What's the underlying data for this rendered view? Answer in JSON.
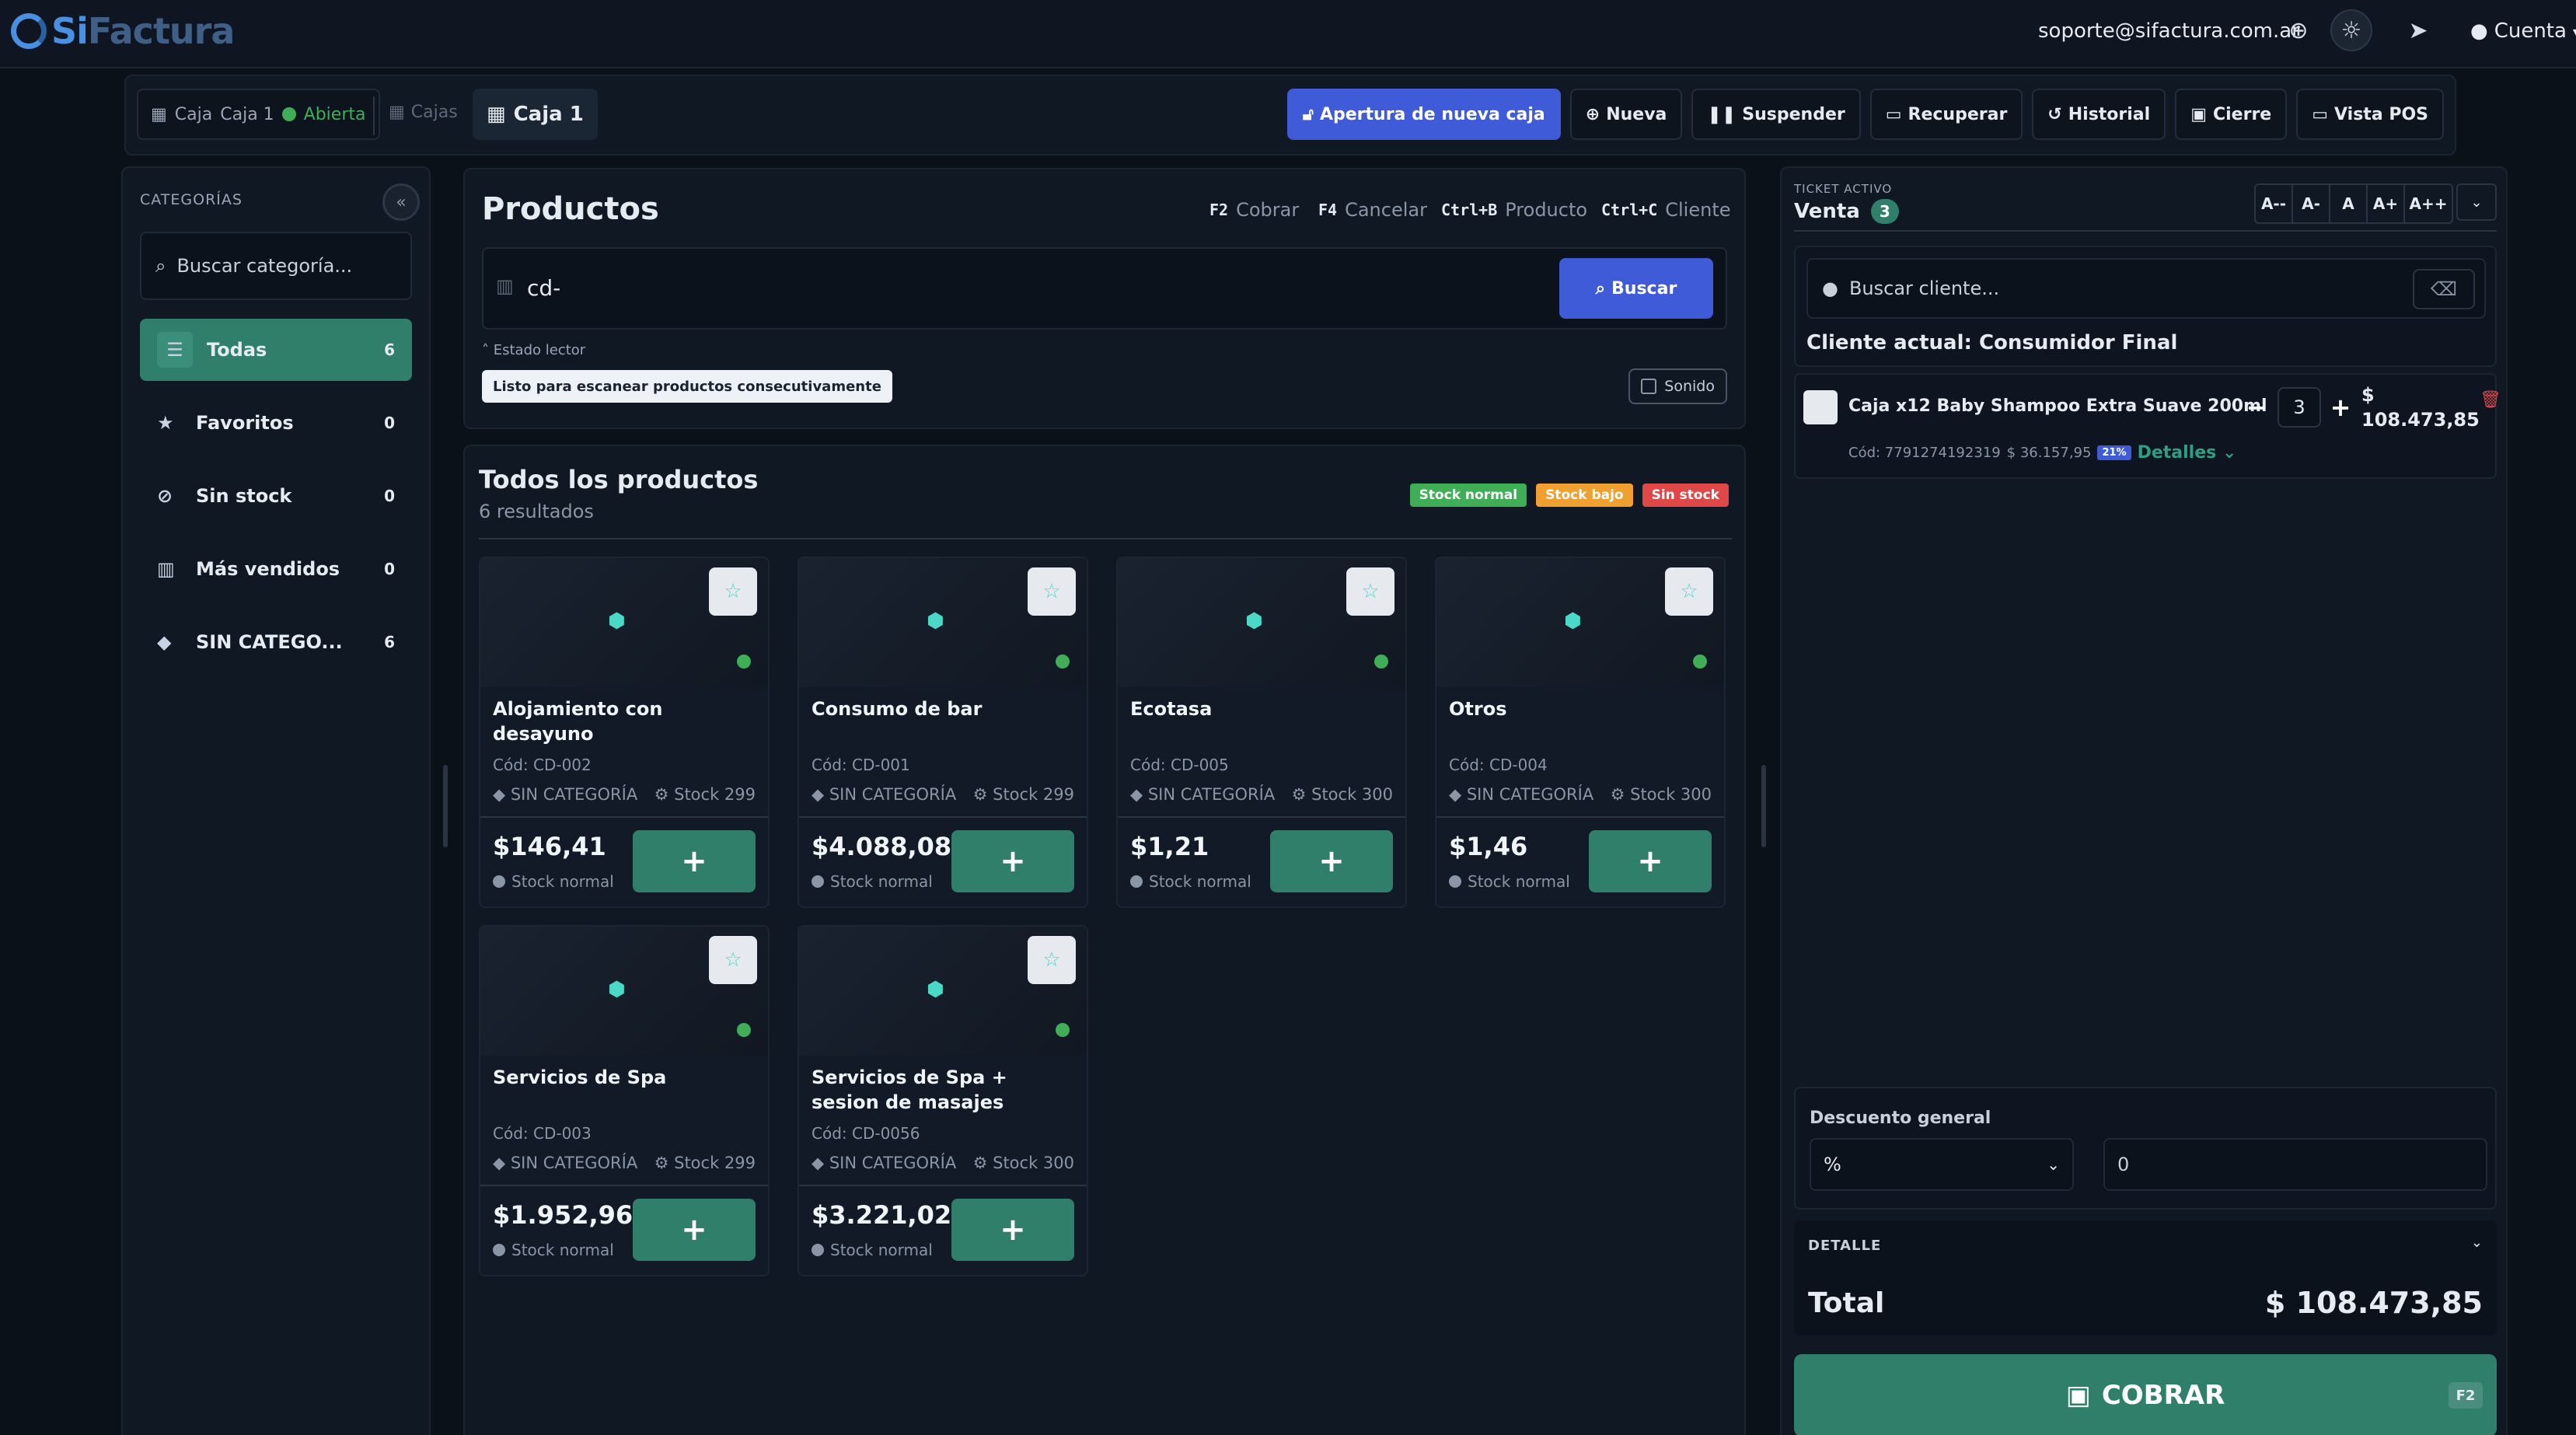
{
  "app": {
    "logo_si": "Si",
    "logo_factura": "Factura"
  },
  "topbar": {
    "email": "soporte@sifactura.com.ar",
    "account_label": "Cuenta"
  },
  "subheader": {
    "caja_chip": {
      "label": "Caja",
      "caja_name": "Caja 1",
      "status": "Abierta"
    },
    "cajas_label": "Cajas",
    "current_caja": "Caja 1",
    "buttons": [
      {
        "label": "Apertura de nueva caja"
      },
      {
        "label": "Nueva"
      },
      {
        "label": "Suspender"
      },
      {
        "label": "Recuperar"
      },
      {
        "label": "Historial"
      },
      {
        "label": "Cierre"
      },
      {
        "label": "Vista POS"
      }
    ]
  },
  "categories": {
    "title": "CATEGORÍAS",
    "search_placeholder": "Buscar categoría...",
    "items": [
      {
        "label": "Todas",
        "count": "6"
      },
      {
        "label": "Favoritos",
        "count": "0"
      },
      {
        "label": "Sin stock",
        "count": "0"
      },
      {
        "label": "Más vendidos",
        "count": "0"
      },
      {
        "label": "SIN CATEGO...",
        "count": "6"
      }
    ]
  },
  "products": {
    "title": "Productos",
    "shortcuts": [
      {
        "key": "F2",
        "label": "Cobrar"
      },
      {
        "key": "F4",
        "label": "Cancelar"
      },
      {
        "key": "Ctrl+B",
        "label": "Producto"
      },
      {
        "key": "Ctrl+C",
        "label": "Cliente"
      }
    ],
    "scan_value": "cd-",
    "buscar_label": "Buscar",
    "estado_label": "Estado lector",
    "listo_text": "Listo para escanear productos consecutivamente",
    "sonido_label": "Sonido"
  },
  "grid": {
    "title": "Todos los productos",
    "results": "6 resultados",
    "legend": [
      {
        "label": "Stock normal",
        "color": "#3fae56"
      },
      {
        "label": "Stock bajo",
        "color": "#f0a030"
      },
      {
        "label": "Sin stock",
        "color": "#e04848"
      }
    ],
    "items": [
      {
        "name": "Alojamiento con desayuno",
        "code": "Cód: CD-002",
        "category": "SIN CATEGORÍA",
        "stock": "Stock 299",
        "price": "$146,41",
        "status": "Stock normal"
      },
      {
        "name": "Consumo de bar",
        "code": "Cód: CD-001",
        "category": "SIN CATEGORÍA",
        "stock": "Stock 299",
        "price": "$4.088,08",
        "status": "Stock normal"
      },
      {
        "name": "Ecotasa",
        "code": "Cód: CD-005",
        "category": "SIN CATEGORÍA",
        "stock": "Stock 300",
        "price": "$1,21",
        "status": "Stock normal"
      },
      {
        "name": "Otros",
        "code": "Cód: CD-004",
        "category": "SIN CATEGORÍA",
        "stock": "Stock 300",
        "price": "$1,46",
        "status": "Stock normal"
      },
      {
        "name": "Servicios de Spa",
        "code": "Cód: CD-003",
        "category": "SIN CATEGORÍA",
        "stock": "Stock 299",
        "price": "$1.952,96",
        "status": "Stock normal"
      },
      {
        "name": "Servicios de Spa + sesion de masajes",
        "code": "Cód: CD-0056",
        "category": "SIN CATEGORÍA",
        "stock": "Stock 300",
        "price": "$3.221,02",
        "status": "Stock normal"
      }
    ]
  },
  "ticket": {
    "label": "TICKET ACTIVO",
    "title": "Venta",
    "count": "3",
    "font_sizes": [
      "A--",
      "A-",
      "A",
      "A+",
      "A++"
    ],
    "customer_placeholder": "Buscar cliente...",
    "current_customer": "Cliente actual: Consumidor Final",
    "line": {
      "name": "Caja x12 Baby Shampoo Extra Suave 200ml",
      "code": "Cód: 7791274192319",
      "unit_price": "$ 36.157,95",
      "iva": "21%",
      "details_label": "Detalles",
      "qty": "3",
      "currency": "$",
      "amount": "108.473,85"
    },
    "discount": {
      "label": "Descuento general",
      "type": "%",
      "value": "0"
    },
    "detail_label": "DETALLE",
    "total_label": "Total",
    "total_value": "$ 108.473,85",
    "cobrar_label": "COBRAR",
    "cobrar_key": "F2"
  }
}
